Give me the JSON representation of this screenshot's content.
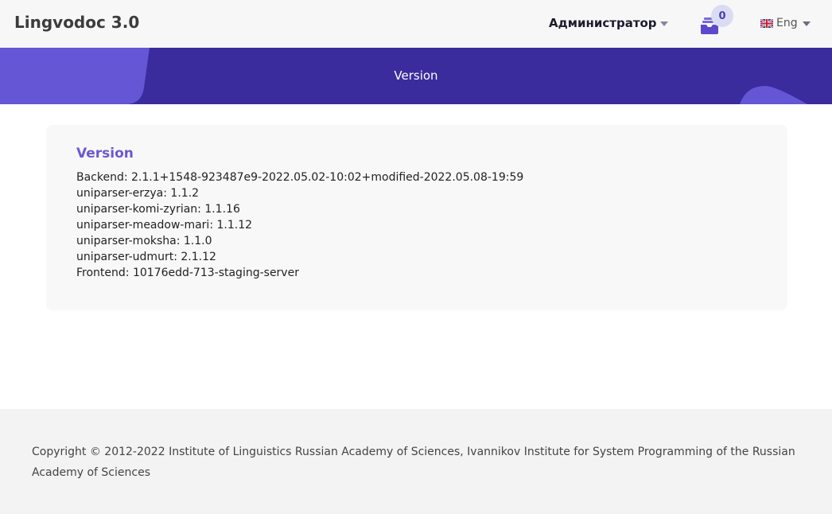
{
  "header": {
    "brand": "Lingvodoc 3.0",
    "user_label": "Администратор",
    "notification_count": "0",
    "language_label": "Eng"
  },
  "banner": {
    "title": "Version"
  },
  "version_card": {
    "title": "Version",
    "entries": [
      "Backend:  2.1.1+1548-923487e9-2022.05.02-10:02+modified-2022.05.08-19:59",
      "uniparser-erzya:  1.1.2",
      "uniparser-komi-zyrian:  1.1.16",
      "uniparser-meadow-mari:  1.1.12",
      "uniparser-moksha:  1.1.0",
      "uniparser-udmurt:  2.1.12",
      "Frontend:  10176edd-713-staging-server"
    ]
  },
  "footer": {
    "copyright": "Copyright © 2012-2022  Institute of Linguistics Russian Academy of Sciences, Ivannikov Institute for System Programming of the Russian Academy of Sciences"
  },
  "colors": {
    "banner": "#3b2c9e",
    "accent": "#6c57d2",
    "badge_bg": "#d9dcf3"
  }
}
